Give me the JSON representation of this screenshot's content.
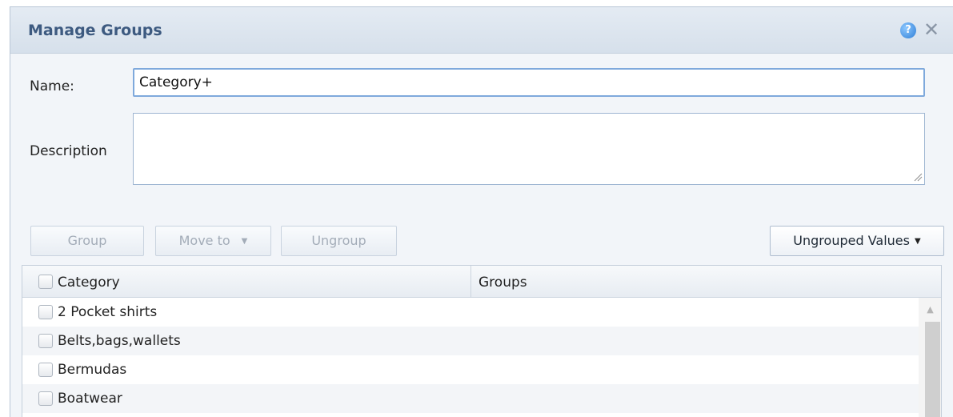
{
  "dialog": {
    "title": "Manage Groups",
    "help_icon": "question-circle-icon",
    "close_icon": "close-icon",
    "help_glyph": "?",
    "close_glyph": "✕"
  },
  "form": {
    "name_label": "Name:",
    "name_value": "Category+",
    "description_label": "Description",
    "description_value": ""
  },
  "toolbar": {
    "group_label": "Group",
    "move_to_label": "Move to",
    "ungroup_label": "Ungroup",
    "ungrouped_values_label": "Ungrouped Values",
    "caret": "▼"
  },
  "grid": {
    "columns": [
      "Category",
      "Groups"
    ],
    "rows": [
      {
        "category": "2 Pocket shirts",
        "group": ""
      },
      {
        "category": "Belts,bags,wallets",
        "group": ""
      },
      {
        "category": "Bermudas",
        "group": ""
      },
      {
        "category": "Boatwear",
        "group": ""
      }
    ],
    "scroll_up_glyph": "▲"
  },
  "colors": {
    "title": "#3d5a80",
    "accent_border": "#7fa9dc",
    "disabled_text": "#a3acb8"
  }
}
